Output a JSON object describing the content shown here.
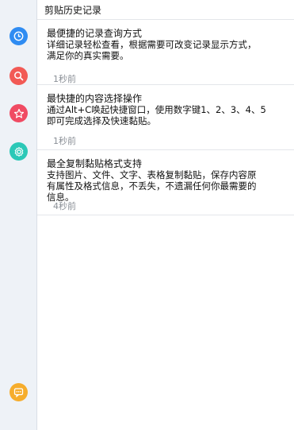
{
  "title": "剪贴历史记录",
  "nav": [
    "history-clock-icon",
    "search-icon",
    "star-icon",
    "settings-gear-icon",
    "chat-icon"
  ],
  "records": [
    {
      "title": "最便捷的记录查询方式",
      "body": "详细记录轻松查看，根据需要可改变记录显示方式，\n满足你的真实需要。",
      "time": "1秒前"
    },
    {
      "title": "最快捷的内容选择操作",
      "body": "通过Alt+C唤起快捷窗口，使用数字键1、2、3、4、5\n即可完成选择及快速黏贴。",
      "time": "1秒前"
    },
    {
      "title": "最全复制黏贴格式支持",
      "body": "支持图片、文件、文字、表格复制黏贴，保存内容原\n有属性及格式信息，不丢失，不遗漏任何你最需要的\n信息。",
      "time": "4秒前"
    }
  ]
}
